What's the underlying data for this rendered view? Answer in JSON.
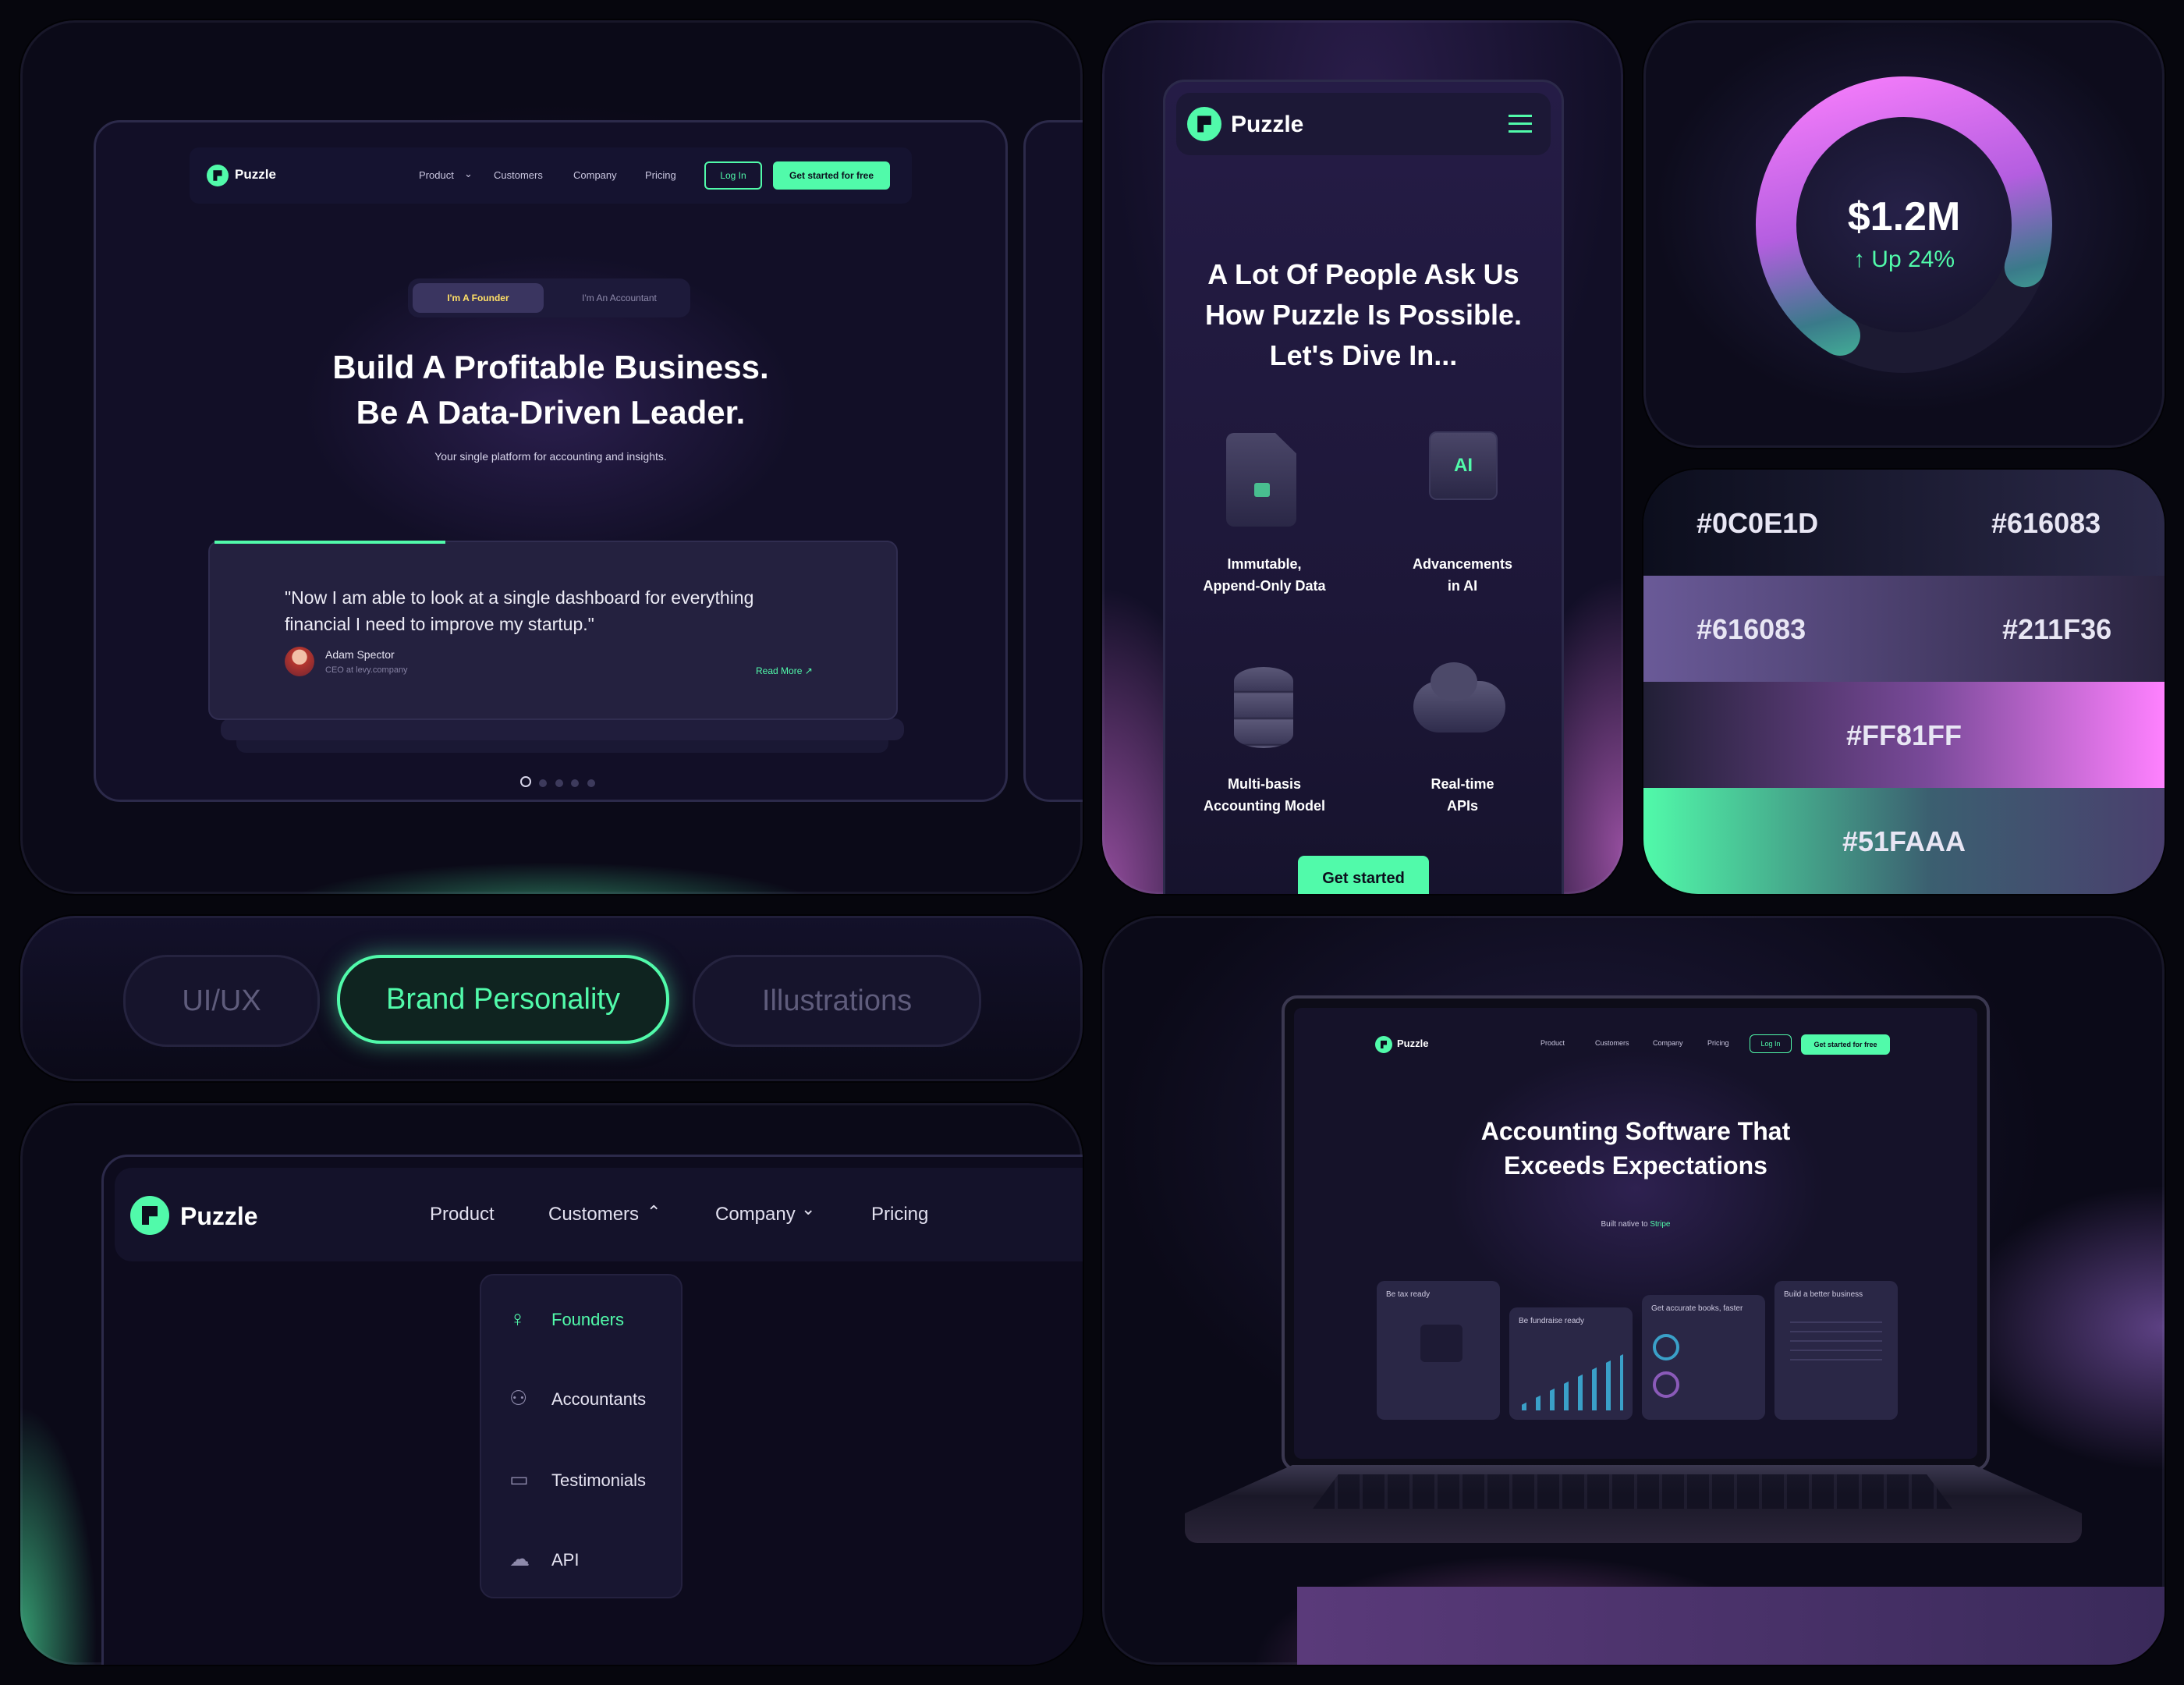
{
  "desktop": {
    "logo": "Puzzle",
    "nav": {
      "product": "Product",
      "customers": "Customers",
      "company": "Company",
      "pricing": "Pricing",
      "login": "Log In",
      "cta": "Get started for free"
    },
    "toggle": {
      "founder": "I'm A Founder",
      "accountant": "I'm An Accountant"
    },
    "headline1": "Build A Profitable Business.",
    "headline2": "Be A Data-Driven Leader.",
    "subtitle": "Your single platform for accounting and insights.",
    "quote": "\"Now I am able to look at a single dashboard for everything financial I need to improve my startup.\"",
    "author": "Adam Spector",
    "author_role": "CEO at levy.company",
    "read_more": "Read More"
  },
  "mobile": {
    "logo": "Puzzle",
    "headline": [
      "A Lot Of People Ask Us",
      "How Puzzle Is Possible.",
      "Let's Dive In..."
    ],
    "features": [
      {
        "icon": "lock-document-icon",
        "line1": "Immutable,",
        "line2": "Append-Only Data"
      },
      {
        "icon": "ai-chip-icon",
        "line1": "Advancements",
        "line2": "in AI"
      },
      {
        "icon": "database-icon",
        "line1": "Multi-basis",
        "line2": "Accounting Model"
      },
      {
        "icon": "cloud-sync-icon",
        "line1": "Real-time",
        "line2": "APIs"
      }
    ],
    "cta": "Get started"
  },
  "metric": {
    "value": "$1.2M",
    "change": "Up 24%",
    "progress": 0.72
  },
  "palette": {
    "row1": [
      "#0C0E1D",
      "#616083"
    ],
    "row2": [
      "#616083",
      "#211F36"
    ],
    "row3": "#FF81FF",
    "row4": "#51FAAA"
  },
  "tabs": {
    "uiux": "UI/UX",
    "brand": "Brand Personality",
    "illustrations": "Illustrations"
  },
  "dropdown_nav": {
    "logo": "Puzzle",
    "product": "Product",
    "customers": "Customers",
    "company": "Company",
    "pricing": "Pricing",
    "menu": [
      {
        "icon": "lightbulb-icon",
        "label": "Founders"
      },
      {
        "icon": "accountant-icon",
        "label": "Accountants"
      },
      {
        "icon": "chat-bubble-icon",
        "label": "Testimonials"
      },
      {
        "icon": "cloud-icon",
        "label": "API"
      }
    ]
  },
  "laptop": {
    "logo": "Puzzle",
    "nav": {
      "product": "Product",
      "customers": "Customers",
      "company": "Company",
      "pricing": "Pricing",
      "login": "Log In",
      "cta": "Get started for free"
    },
    "headline1": "Accounting Software That",
    "headline2": "Exceeds Expectations",
    "native_prefix": "Built native to",
    "native_brand": "Stripe",
    "cards": [
      "Be tax ready",
      "Be fundraise ready",
      "Get accurate books, faster",
      "Build a better business"
    ]
  },
  "colors": {
    "mint": "#51FAAA",
    "pink": "#FF81FF",
    "navy": "#0C0E1D",
    "grey_violet": "#616083",
    "deep_violet": "#211F36"
  }
}
